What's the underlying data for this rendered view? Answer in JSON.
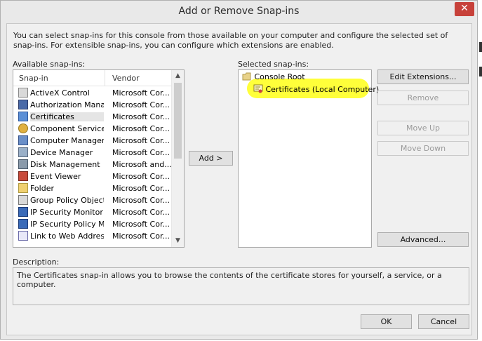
{
  "window": {
    "title": "Add or Remove Snap-ins",
    "close_glyph": "✕"
  },
  "intro_text": "You can select snap-ins for this console from those available on your computer and configure the selected set of snap-ins. For extensible snap-ins, you can configure which extensions are enabled.",
  "available": {
    "label": "Available snap-ins:",
    "col_snapin": "Snap-in",
    "col_vendor": "Vendor",
    "items": [
      {
        "name": "ActiveX Control",
        "vendor": "Microsoft Cor...",
        "icon": "activex-icon"
      },
      {
        "name": "Authorization Manager",
        "vendor": "Microsoft Cor...",
        "icon": "authorization-icon"
      },
      {
        "name": "Certificates",
        "vendor": "Microsoft Cor...",
        "icon": "certificates-icon"
      },
      {
        "name": "Component Services",
        "vendor": "Microsoft Cor...",
        "icon": "component-services-icon"
      },
      {
        "name": "Computer Managem...",
        "vendor": "Microsoft Cor...",
        "icon": "computer-management-icon"
      },
      {
        "name": "Device Manager",
        "vendor": "Microsoft Cor...",
        "icon": "device-manager-icon"
      },
      {
        "name": "Disk Management",
        "vendor": "Microsoft and...",
        "icon": "disk-management-icon"
      },
      {
        "name": "Event Viewer",
        "vendor": "Microsoft Cor...",
        "icon": "event-viewer-icon"
      },
      {
        "name": "Folder",
        "vendor": "Microsoft Cor...",
        "icon": "folder-icon"
      },
      {
        "name": "Group Policy Object ...",
        "vendor": "Microsoft Cor...",
        "icon": "group-policy-icon"
      },
      {
        "name": "IP Security Monitor",
        "vendor": "Microsoft Cor...",
        "icon": "ip-security-monitor-icon"
      },
      {
        "name": "IP Security Policy M...",
        "vendor": "Microsoft Cor...",
        "icon": "ip-security-policy-icon"
      },
      {
        "name": "Link to Web Address",
        "vendor": "Microsoft Cor...",
        "icon": "link-icon"
      }
    ]
  },
  "add_button": "Add >",
  "selected": {
    "label": "Selected snap-ins:",
    "root": "Console Root",
    "child": "Certificates (Local Computer)"
  },
  "side_buttons": {
    "edit_extensions": "Edit Extensions...",
    "remove": "Remove",
    "move_up": "Move Up",
    "move_down": "Move Down",
    "advanced": "Advanced..."
  },
  "description": {
    "label": "Description:",
    "text": "The Certificates snap-in allows you to browse the contents of the certificate stores for yourself, a service, or a computer."
  },
  "footer": {
    "ok": "OK",
    "cancel": "Cancel"
  },
  "colors": {
    "highlight": "#ffff3a",
    "close_button": "#c7413a",
    "dialog_bg": "#f0f0f0"
  }
}
